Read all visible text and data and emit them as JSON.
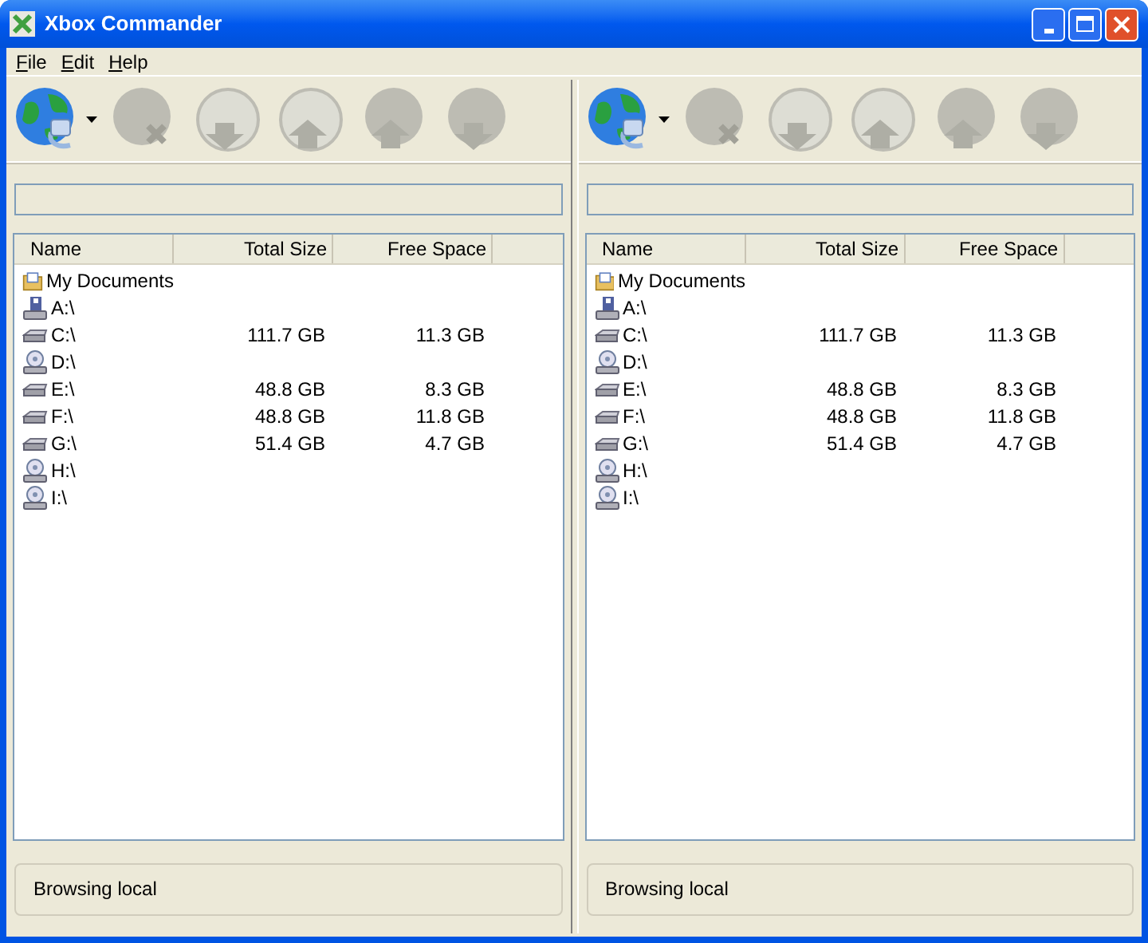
{
  "window": {
    "title": "Xbox Commander"
  },
  "menu": [
    "File",
    "Edit",
    "Help"
  ],
  "panes": [
    {
      "toolbar": [
        {
          "kind": "connect",
          "disabled": false,
          "dropdown": true
        },
        {
          "kind": "disconnect",
          "disabled": true
        },
        {
          "kind": "download",
          "disabled": true
        },
        {
          "kind": "upload",
          "disabled": true
        },
        {
          "kind": "send",
          "disabled": true
        },
        {
          "kind": "receive",
          "disabled": true
        }
      ],
      "columns": [
        "Name",
        "Total Size",
        "Free Space"
      ],
      "rows": [
        {
          "kind": "folder",
          "name": "My Documents"
        },
        {
          "kind": "floppy",
          "name": "A:\\"
        },
        {
          "kind": "disk",
          "name": "C:\\",
          "total": "111.7 GB",
          "free": "11.3 GB"
        },
        {
          "kind": "cd",
          "name": "D:\\"
        },
        {
          "kind": "disk",
          "name": "E:\\",
          "total": "48.8 GB",
          "free": "8.3 GB"
        },
        {
          "kind": "disk",
          "name": "F:\\",
          "total": "48.8 GB",
          "free": "11.8 GB"
        },
        {
          "kind": "disk",
          "name": "G:\\",
          "total": "51.4 GB",
          "free": "4.7 GB"
        },
        {
          "kind": "cd",
          "name": "H:\\"
        },
        {
          "kind": "cd",
          "name": "I:\\"
        }
      ],
      "status": "Browsing local"
    },
    {
      "toolbar": [
        {
          "kind": "connect",
          "disabled": false,
          "dropdown": true
        },
        {
          "kind": "disconnect",
          "disabled": true
        },
        {
          "kind": "download",
          "disabled": true
        },
        {
          "kind": "upload",
          "disabled": true
        },
        {
          "kind": "send",
          "disabled": true
        },
        {
          "kind": "receive",
          "disabled": true
        }
      ],
      "columns": [
        "Name",
        "Total Size",
        "Free Space"
      ],
      "rows": [
        {
          "kind": "folder",
          "name": "My Documents"
        },
        {
          "kind": "floppy",
          "name": "A:\\"
        },
        {
          "kind": "disk",
          "name": "C:\\",
          "total": "111.7 GB",
          "free": "11.3 GB"
        },
        {
          "kind": "cd",
          "name": "D:\\"
        },
        {
          "kind": "disk",
          "name": "E:\\",
          "total": "48.8 GB",
          "free": "8.3 GB"
        },
        {
          "kind": "disk",
          "name": "F:\\",
          "total": "48.8 GB",
          "free": "11.8 GB"
        },
        {
          "kind": "disk",
          "name": "G:\\",
          "total": "51.4 GB",
          "free": "4.7 GB"
        },
        {
          "kind": "cd",
          "name": "H:\\"
        },
        {
          "kind": "cd",
          "name": "I:\\"
        }
      ],
      "status": "Browsing local"
    }
  ]
}
